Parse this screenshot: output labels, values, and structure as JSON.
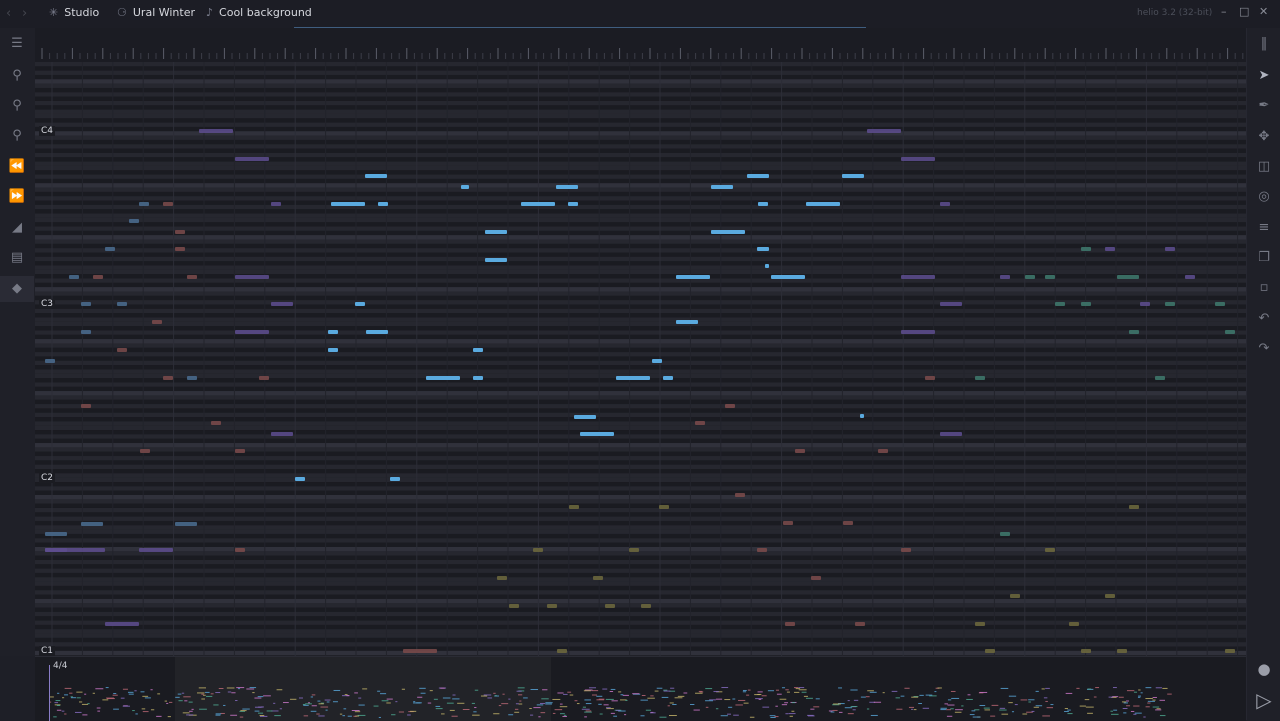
{
  "titlebar": {
    "crumbs": [
      {
        "label": "Studio",
        "icon": "gear-icon"
      },
      {
        "label": "Ural Winter",
        "icon": "guitar-icon"
      },
      {
        "label": "Cool background",
        "icon": "music-note-icon"
      }
    ],
    "app_version": "helio 3.2 (32-bit)"
  },
  "left_tools": [
    "hamburger-icon",
    "zoom-icon",
    "zoom-in-icon",
    "zoom-out-icon",
    "rewind-icon",
    "fast-forward-icon",
    "ramp-icon",
    "paint-roller-icon",
    "tag-icon"
  ],
  "right_tools": [
    "panel-toggle-icon",
    "cursor-icon",
    "pen-icon",
    "move-icon",
    "split-icon",
    "target-icon",
    "arpeggio-icon",
    "copy-icon",
    "paste-icon",
    "undo-icon",
    "redo-icon"
  ],
  "roll": {
    "octave_labels": [
      "C4",
      "C3",
      "C2",
      "C1"
    ],
    "colors": {
      "active": "#5aaadf",
      "purple": "#5e4e8f",
      "red": "#7d4b4b",
      "teal": "#3f7a6d",
      "blue": "#4b6d91",
      "yellow": "#6f6a3d"
    }
  },
  "minimap": {
    "time_signature": "4/4"
  },
  "transport": {
    "record": "record-icon",
    "play": "play-icon"
  }
}
